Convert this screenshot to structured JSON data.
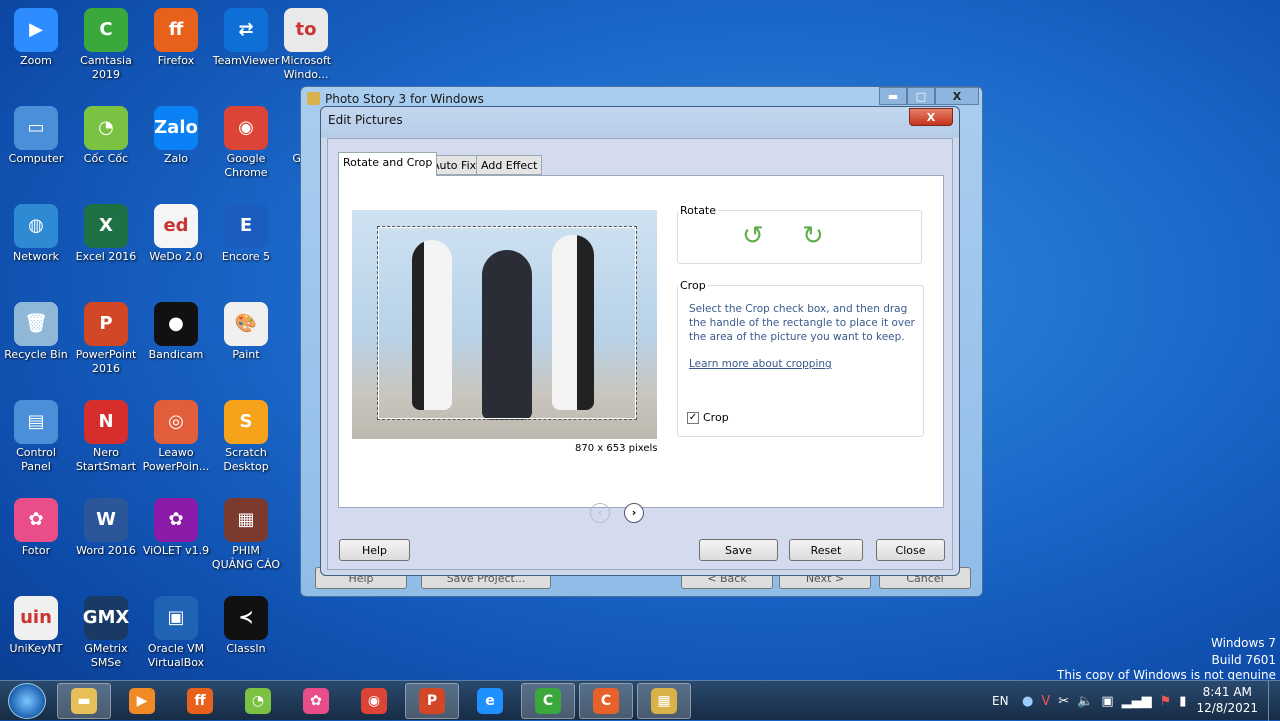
{
  "desktop": {
    "icons": [
      {
        "label": "Zoom",
        "color": "#2d8cff",
        "glyph": "▶"
      },
      {
        "label": "Camtasia 2019",
        "color": "#3aa83a",
        "glyph": "C"
      },
      {
        "label": "Firefox",
        "color": "#e8611a",
        "glyph": "ff"
      },
      {
        "label": "TeamViewer",
        "color": "#0e6fd6",
        "glyph": "⇄"
      },
      {
        "label": "Microsoft Windo...",
        "color": "#e9e9e9",
        "glyph": "to"
      },
      {
        "label": "Computer",
        "color": "#4a90d9",
        "glyph": "▭"
      },
      {
        "label": "Cốc Cốc",
        "color": "#7cc242",
        "glyph": "◔"
      },
      {
        "label": "Zalo",
        "color": "#0a82f5",
        "glyph": "Zalo"
      },
      {
        "label": "Google Chrome",
        "color": "#db4437",
        "glyph": "◉"
      },
      {
        "label": "Go",
        "color": "#1a66c7",
        "glyph": ""
      },
      {
        "label": "Network",
        "color": "#2e8bd3",
        "glyph": "◍"
      },
      {
        "label": "Excel 2016",
        "color": "#1e7145",
        "glyph": "X"
      },
      {
        "label": "WeDo 2.0",
        "color": "#f5f5f5",
        "glyph": "ed"
      },
      {
        "label": "Encore 5",
        "color": "#1a5dbf",
        "glyph": "E"
      },
      {
        "label": "Recycle Bin",
        "color": "#8fb8d8",
        "glyph": "🗑"
      },
      {
        "label": "PowerPoint 2016",
        "color": "#d24726",
        "glyph": "P"
      },
      {
        "label": "Bandicam",
        "color": "#111111",
        "glyph": "●"
      },
      {
        "label": "Paint",
        "color": "#f0f0f0",
        "glyph": "🎨"
      },
      {
        "label": "Control Panel",
        "color": "#4a90d9",
        "glyph": "▤"
      },
      {
        "label": "Nero StartSmart",
        "color": "#d62d2d",
        "glyph": "N"
      },
      {
        "label": "Leawo PowerPoin...",
        "color": "#e25d3a",
        "glyph": "◎"
      },
      {
        "label": "Scratch Desktop",
        "color": "#f7a21b",
        "glyph": "S"
      },
      {
        "label": "Fotor",
        "color": "#e94d8a",
        "glyph": "✿"
      },
      {
        "label": "Word 2016",
        "color": "#2b579a",
        "glyph": "W"
      },
      {
        "label": "ViOLET v1.9",
        "color": "#8a1aa8",
        "glyph": "✿"
      },
      {
        "label": "PHIM QUẢNG CÁO",
        "color": "#7a3b2e",
        "glyph": "▦"
      },
      {
        "label": "UniKeyNT",
        "color": "#f0f0f0",
        "glyph": "uin"
      },
      {
        "label": "GMetrix SMSe",
        "color": "#1a3a66",
        "glyph": "GMX"
      },
      {
        "label": "Oracle VM VirtualBox",
        "color": "#1f63b5",
        "glyph": "▣"
      },
      {
        "label": "ClassIn",
        "color": "#111111",
        "glyph": "≺"
      }
    ]
  },
  "watermark": {
    "line1": "Windows 7",
    "line2": "Build 7601",
    "line3": "This copy of Windows is not genuine"
  },
  "main_window": {
    "title": "Photo Story 3 for Windows",
    "bg_buttons": [
      "Help",
      "Save Project...",
      "< Back",
      "Next >",
      "Cancel"
    ]
  },
  "dialog": {
    "title": "Edit Pictures",
    "close": "X",
    "tabs": [
      "Rotate and Crop",
      "Auto Fix",
      "Add Effect"
    ],
    "selected_tab": 0,
    "image_size": "870 x 653 pixels",
    "rotate": {
      "label": "Rotate"
    },
    "crop": {
      "label": "Crop",
      "instructions": "Select the Crop check box, and then drag the handle of the rectangle to place it over the area of the picture you want to keep.",
      "link": "Learn more about cropping",
      "checkbox_label": "Crop",
      "checked": true
    },
    "buttons": {
      "help": "Help",
      "save": "Save",
      "reset": "Reset",
      "close": "Close"
    }
  },
  "taskbar": {
    "items": [
      {
        "name": "explorer",
        "color": "#e8c05a",
        "glyph": "▬",
        "active": true
      },
      {
        "name": "media-player",
        "color": "#f08a24",
        "glyph": "▶",
        "active": false
      },
      {
        "name": "firefox",
        "color": "#e8611a",
        "glyph": "ff",
        "active": false
      },
      {
        "name": "coccoc",
        "color": "#7cc242",
        "glyph": "◔",
        "active": false
      },
      {
        "name": "fotor",
        "color": "#e94d8a",
        "glyph": "✿",
        "active": false
      },
      {
        "name": "chrome",
        "color": "#db4437",
        "glyph": "◉",
        "active": false
      },
      {
        "name": "powerpoint",
        "color": "#d24726",
        "glyph": "P",
        "active": true
      },
      {
        "name": "internet-explorer",
        "color": "#1e90ff",
        "glyph": "e",
        "active": false
      },
      {
        "name": "camtasia",
        "color": "#3aa83a",
        "glyph": "C",
        "active": true
      },
      {
        "name": "camtasia-recorder",
        "color": "#e8612a",
        "glyph": "C",
        "active": true
      },
      {
        "name": "photo-story",
        "color": "#d9b24a",
        "glyph": "▦",
        "active": true
      }
    ],
    "language": "EN",
    "time": "8:41 AM",
    "date": "12/8/2021"
  }
}
